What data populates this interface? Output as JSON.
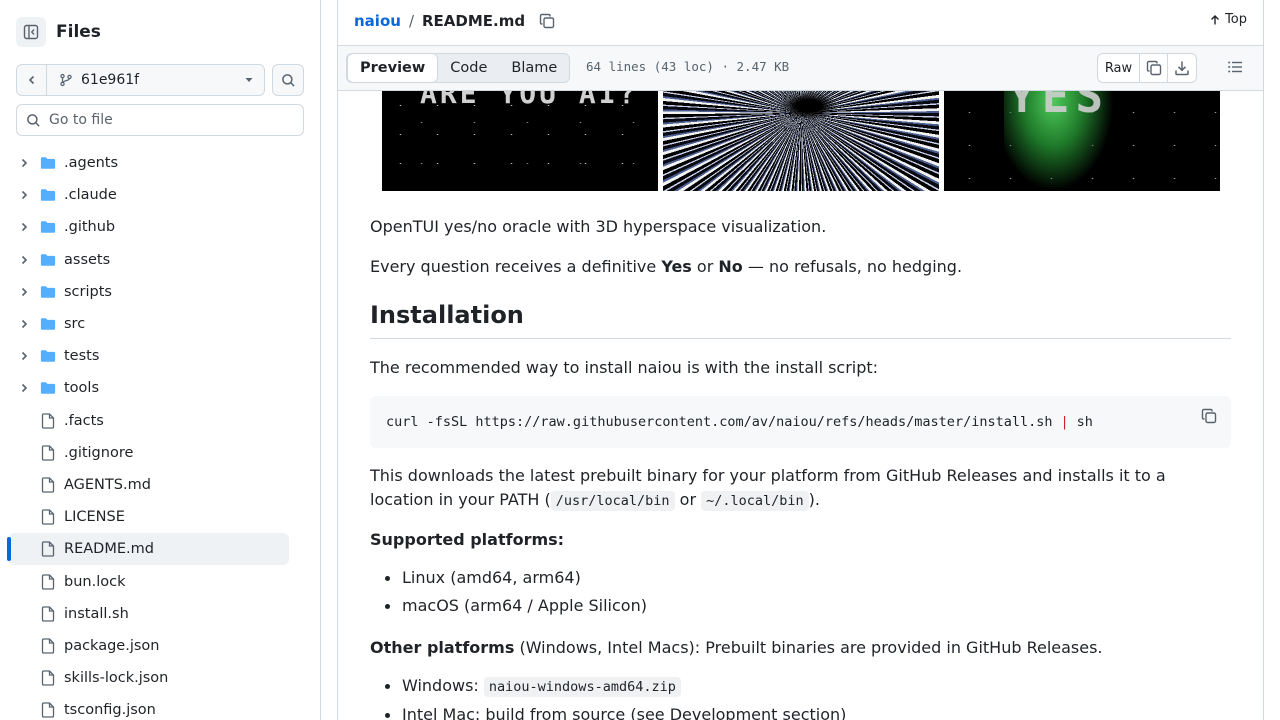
{
  "sidebar": {
    "title": "Files",
    "branch": "61e961f",
    "goto_placeholder": "Go to file",
    "items": [
      {
        "label": ".agents",
        "type": "folder"
      },
      {
        "label": ".claude",
        "type": "folder"
      },
      {
        "label": ".github",
        "type": "folder"
      },
      {
        "label": "assets",
        "type": "folder"
      },
      {
        "label": "scripts",
        "type": "folder"
      },
      {
        "label": "src",
        "type": "folder"
      },
      {
        "label": "tests",
        "type": "folder"
      },
      {
        "label": "tools",
        "type": "folder"
      },
      {
        "label": ".facts",
        "type": "file"
      },
      {
        "label": ".gitignore",
        "type": "file"
      },
      {
        "label": "AGENTS.md",
        "type": "file"
      },
      {
        "label": "LICENSE",
        "type": "file"
      },
      {
        "label": "README.md",
        "type": "file",
        "active": true
      },
      {
        "label": "bun.lock",
        "type": "file"
      },
      {
        "label": "install.sh",
        "type": "file"
      },
      {
        "label": "package.json",
        "type": "file"
      },
      {
        "label": "skills-lock.json",
        "type": "file"
      },
      {
        "label": "tsconfig.json",
        "type": "file"
      }
    ]
  },
  "header": {
    "repo": "naiou",
    "separator": "/",
    "file": "README.md",
    "top_label": "Top"
  },
  "toolbar": {
    "tabs": [
      "Preview",
      "Code",
      "Blame"
    ],
    "active_tab": "Preview",
    "meta": "64 lines (43 loc) · 2.47 KB",
    "raw_label": "Raw"
  },
  "banner": {
    "shot1_text": "ARE YOU AI?",
    "shot3_text": "YES"
  },
  "readme": {
    "intro": "OpenTUI yes/no oracle with 3D hyperspace visualization.",
    "every_pre": "Every question receives a definitive ",
    "every_yes": "Yes",
    "every_or": " or ",
    "every_no": "No",
    "every_post": " — no refusals, no hedging.",
    "install_heading": "Installation",
    "install_intro": "The recommended way to install naiou is with the install script:",
    "code_cmd": "curl -fsSL https://raw.githubusercontent.com/av/naiou/refs/heads/master/install.sh",
    "code_pipe": "|",
    "code_sh": "sh",
    "download_pre": "This downloads the latest prebuilt binary for your platform from GitHub Releases and installs it to a location in your PATH (",
    "path1": "/usr/local/bin",
    "path_or": " or ",
    "path2": "~/.local/bin",
    "download_post": ").",
    "supported_label": "Supported platforms:",
    "supported": [
      "Linux (amd64, arm64)",
      "macOS (arm64 / Apple Silicon)"
    ],
    "other_label": "Other platforms",
    "other_text": " (Windows, Intel Macs): Prebuilt binaries are provided in GitHub Releases.",
    "windows_label": "Windows: ",
    "windows_zip": "naiou-windows-amd64.zip",
    "intel_text": "Intel Mac: build from source (see Development section)"
  },
  "colors": {
    "accent": "#0969da",
    "folder": "#54aeff",
    "border": "#d1d9e0",
    "text": "#1f2328",
    "muted": "#59636e"
  }
}
